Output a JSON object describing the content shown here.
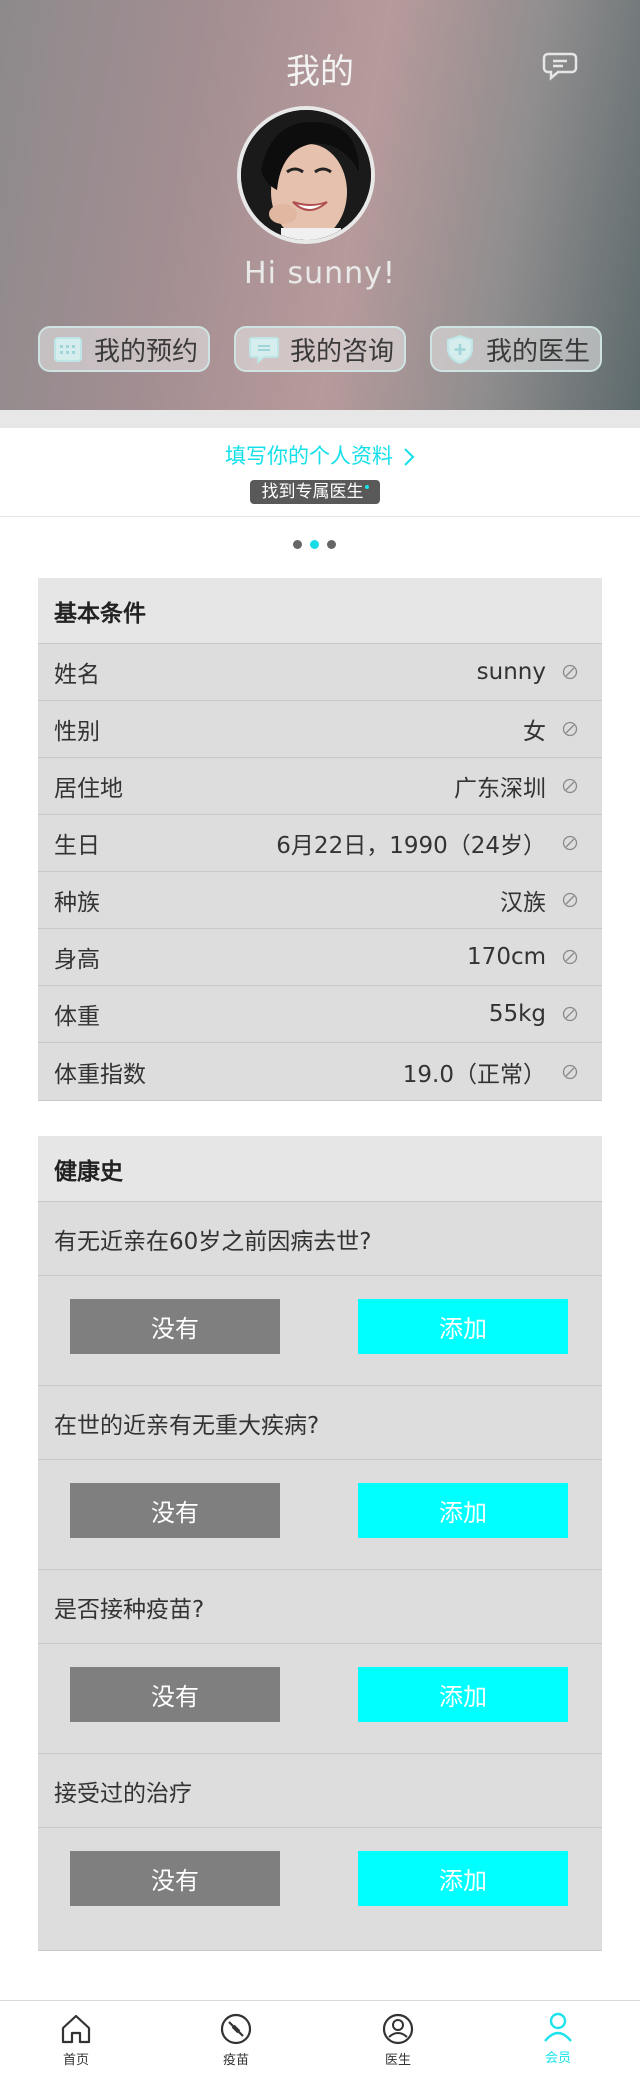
{
  "header": {
    "title": "我的",
    "greeting": "Hi sunny!"
  },
  "quick_actions": [
    {
      "label": "我的预约",
      "icon": "calendar-icon"
    },
    {
      "label": "我的咨询",
      "icon": "chat-icon"
    },
    {
      "label": "我的医生",
      "icon": "shield-plus-icon"
    }
  ],
  "profile_prompt": {
    "link": "填写你的个人资料",
    "find_doctor": "找到专属医生"
  },
  "basic": {
    "title": "基本条件",
    "rows": [
      {
        "key": "姓名",
        "value": "sunny"
      },
      {
        "key": "性别",
        "value": "女"
      },
      {
        "key": "居住地",
        "value": "广东深圳"
      },
      {
        "key": "生日",
        "value": "6月22日，1990（24岁）"
      },
      {
        "key": "种族",
        "value": "汉族"
      },
      {
        "key": "身高",
        "value": "170cm"
      },
      {
        "key": "体重",
        "value": "55kg"
      },
      {
        "key": "体重指数",
        "value": "19.0（正常）"
      }
    ]
  },
  "health": {
    "title": "健康史",
    "no_label": "没有",
    "add_label": "添加",
    "questions": [
      "有无近亲在60岁之前因病去世?",
      "在世的近亲有无重大疾病?",
      "是否接种疫苗?",
      "接受过的治疗"
    ]
  },
  "tabs": [
    {
      "label": "首页",
      "icon": "home-icon"
    },
    {
      "label": "疫苗",
      "icon": "vaccine-icon"
    },
    {
      "label": "医生",
      "icon": "doctor-icon"
    },
    {
      "label": "会员",
      "icon": "user-icon",
      "active": true
    }
  ],
  "colors": {
    "accent": "#00ffff",
    "accent_text": "#15e0ea",
    "no_button": "#7f7f7f",
    "card_bg": "#dedddd"
  }
}
